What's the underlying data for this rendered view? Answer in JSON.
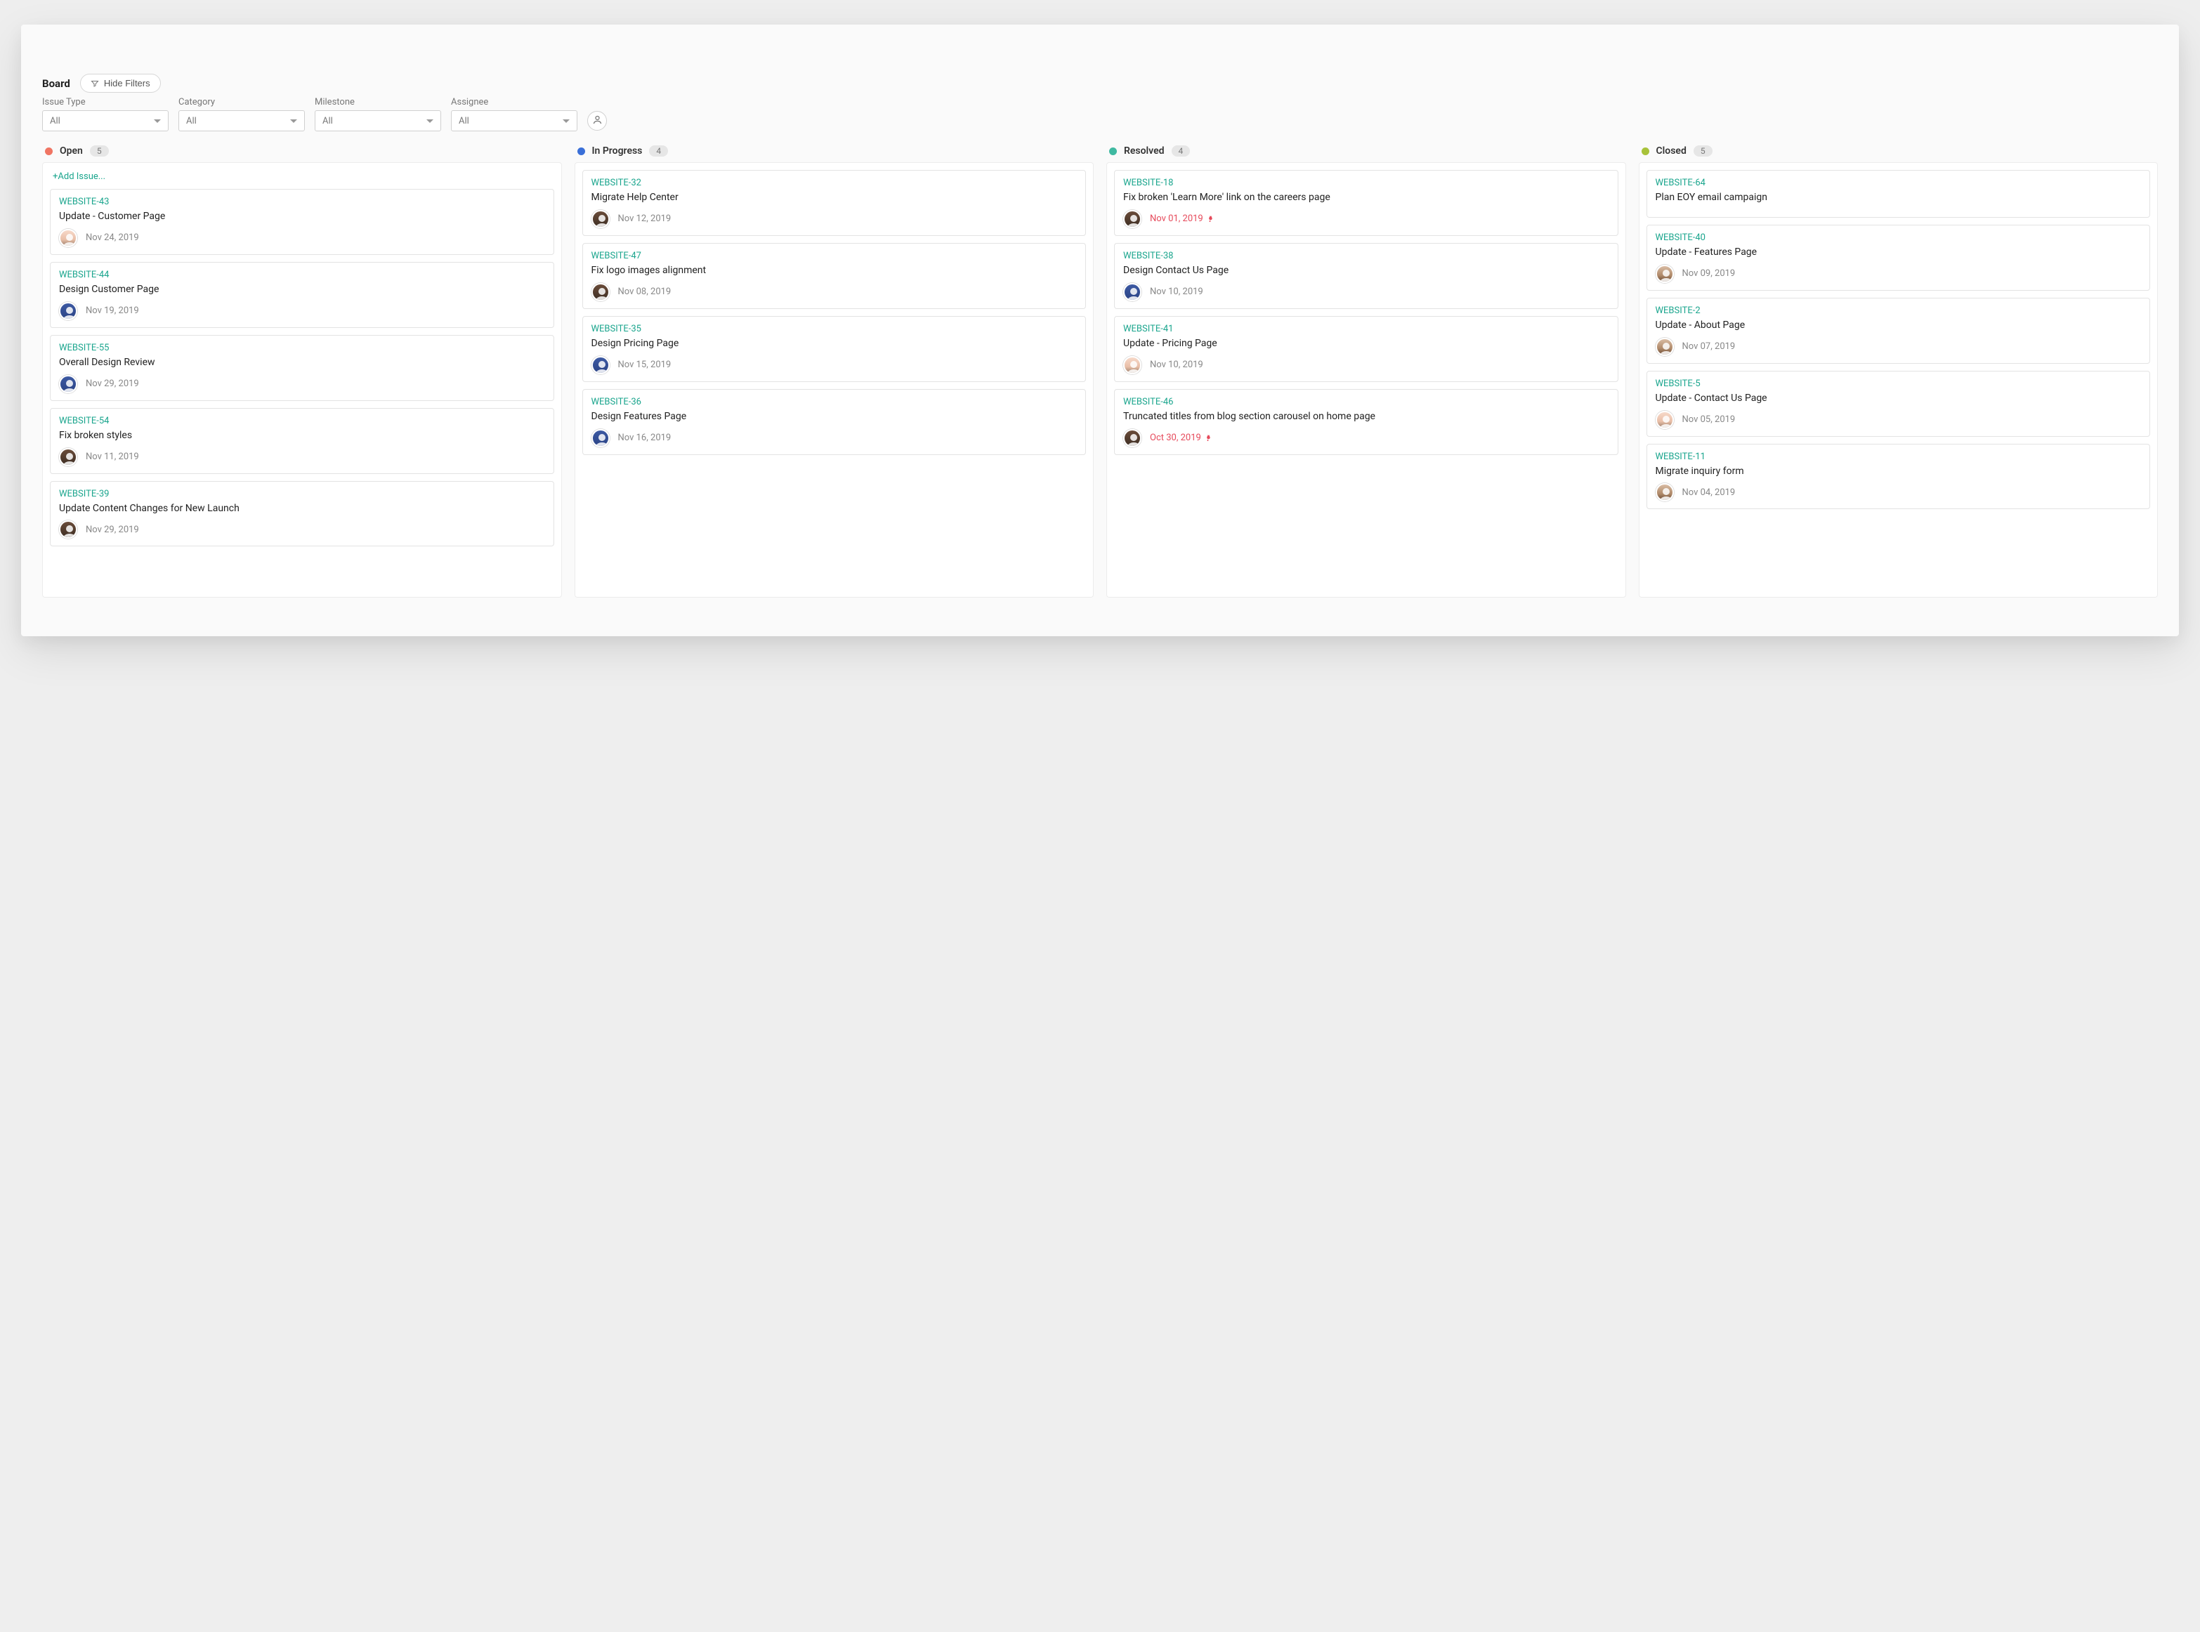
{
  "header": {
    "title": "Board",
    "hide_filters_label": "Hide Filters"
  },
  "filters": {
    "issue_type": {
      "label": "Issue Type",
      "value": "All"
    },
    "category": {
      "label": "Category",
      "value": "All"
    },
    "milestone": {
      "label": "Milestone",
      "value": "All"
    },
    "assignee": {
      "label": "Assignee",
      "value": "All"
    }
  },
  "add_issue_label": "+Add Issue...",
  "columns": [
    {
      "key": "open",
      "title": "Open",
      "count": "5",
      "color": "#f07563",
      "show_add": true,
      "cards": [
        {
          "id": "WEBSITE-43",
          "title": "Update - Customer Page",
          "date": "Nov 24, 2019",
          "avatar": "a",
          "hot": false
        },
        {
          "id": "WEBSITE-44",
          "title": "Design Customer Page",
          "date": "Nov 19, 2019",
          "avatar": "b",
          "hot": false
        },
        {
          "id": "WEBSITE-55",
          "title": "Overall Design Review",
          "date": "Nov 29, 2019",
          "avatar": "b",
          "hot": false
        },
        {
          "id": "WEBSITE-54",
          "title": "Fix broken styles",
          "date": "Nov 11, 2019",
          "avatar": "c",
          "hot": false
        },
        {
          "id": "WEBSITE-39",
          "title": "Update Content Changes for New Launch",
          "date": "Nov 29, 2019",
          "avatar": "c",
          "hot": false
        }
      ]
    },
    {
      "key": "in_progress",
      "title": "In Progress",
      "count": "4",
      "color": "#3a6fd8",
      "show_add": false,
      "cards": [
        {
          "id": "WEBSITE-32",
          "title": "Migrate Help Center",
          "date": "Nov 12, 2019",
          "avatar": "c",
          "hot": false
        },
        {
          "id": "WEBSITE-47",
          "title": "Fix logo images alignment",
          "date": "Nov 08, 2019",
          "avatar": "c",
          "hot": false
        },
        {
          "id": "WEBSITE-35",
          "title": "Design Pricing Page",
          "date": "Nov 15, 2019",
          "avatar": "b",
          "hot": false
        },
        {
          "id": "WEBSITE-36",
          "title": "Design Features Page",
          "date": "Nov 16, 2019",
          "avatar": "b",
          "hot": false
        }
      ]
    },
    {
      "key": "resolved",
      "title": "Resolved",
      "count": "4",
      "color": "#3fb9a1",
      "show_add": false,
      "cards": [
        {
          "id": "WEBSITE-18",
          "title": "Fix broken 'Learn More' link on the careers page",
          "date": "Nov 01, 2019",
          "avatar": "c",
          "hot": true
        },
        {
          "id": "WEBSITE-38",
          "title": "Design Contact Us Page",
          "date": "Nov 10, 2019",
          "avatar": "b",
          "hot": false
        },
        {
          "id": "WEBSITE-41",
          "title": "Update - Pricing Page",
          "date": "Nov 10, 2019",
          "avatar": "a",
          "hot": false
        },
        {
          "id": "WEBSITE-46",
          "title": "Truncated titles from blog section carousel on home page",
          "date": "Oct 30, 2019",
          "avatar": "c",
          "hot": true
        }
      ]
    },
    {
      "key": "closed",
      "title": "Closed",
      "count": "5",
      "color": "#a8c23a",
      "show_add": false,
      "cards": [
        {
          "id": "WEBSITE-64",
          "title": "Plan EOY email campaign",
          "date": "",
          "avatar": "",
          "hot": false
        },
        {
          "id": "WEBSITE-40",
          "title": "Update - Features Page",
          "date": "Nov 09, 2019",
          "avatar": "d",
          "hot": false
        },
        {
          "id": "WEBSITE-2",
          "title": "Update - About Page",
          "date": "Nov 07, 2019",
          "avatar": "d",
          "hot": false
        },
        {
          "id": "WEBSITE-5",
          "title": "Update - Contact Us Page",
          "date": "Nov 05, 2019",
          "avatar": "a",
          "hot": false
        },
        {
          "id": "WEBSITE-11",
          "title": "Migrate inquiry form",
          "date": "Nov 04, 2019",
          "avatar": "d",
          "hot": false
        }
      ]
    }
  ]
}
